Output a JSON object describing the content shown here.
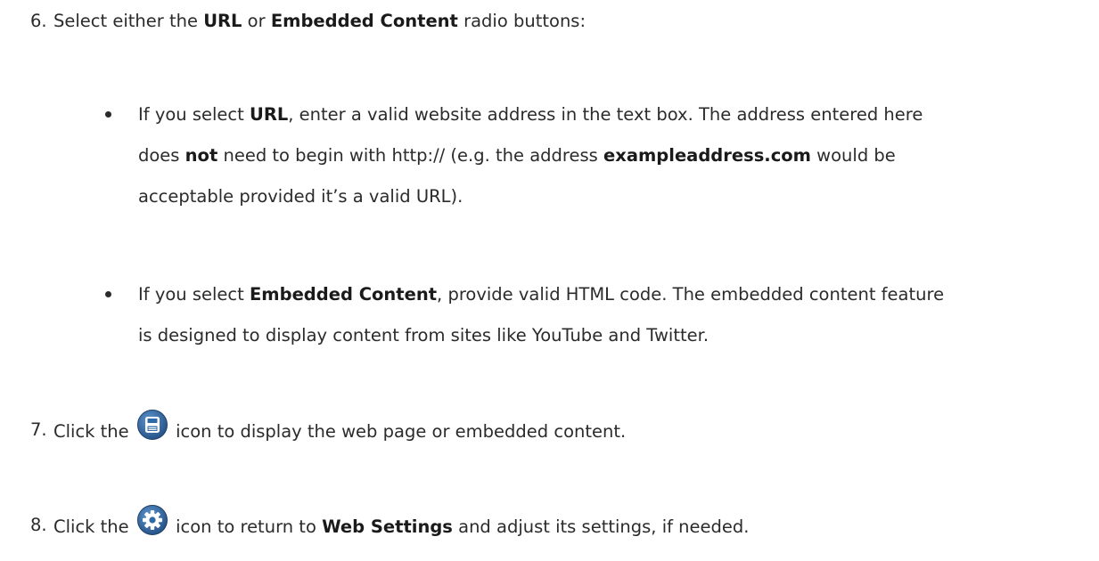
{
  "step6": {
    "number": "6.",
    "text_a": "Select either the ",
    "url": "URL",
    "text_b": " or ",
    "embedded": "Embedded Content",
    "text_c": " radio buttons:"
  },
  "bullet_url": {
    "l1_a": "If you select ",
    "l1_b": "URL",
    "l1_c": ", enter a valid website address in the text box. The address entered here",
    "l2_a": "does ",
    "l2_b": "not",
    "l2_c": " need to begin with http:// (e.g. the address ",
    "l2_d": "exampleaddress.com",
    "l2_e": " would be",
    "l3": "acceptable provided it’s a valid URL)."
  },
  "bullet_embedded": {
    "l1_a": "If you select ",
    "l1_b": "Embedded Content",
    "l1_c": ", provide valid HTML code. The embedded content feature",
    "l2": "is designed to display content from sites like YouTube and Twitter."
  },
  "step7": {
    "number": "7.",
    "text_a": "Click the ",
    "text_b": " icon to display the web page or embedded content."
  },
  "step8": {
    "number": "8.",
    "text_a": "Click the ",
    "text_b": " icon to return to ",
    "web_settings": "Web Settings",
    "text_c": " and adjust its settings, if needed."
  },
  "icons": {
    "save": "save-icon",
    "settings": "gear-icon",
    "icon_color": "#2f6aa8"
  }
}
